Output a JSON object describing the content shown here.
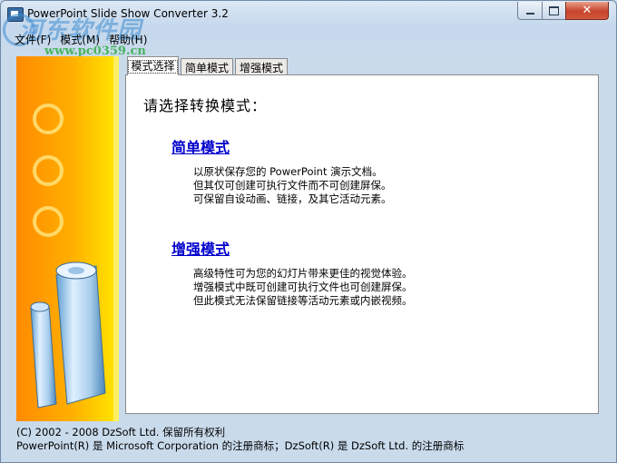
{
  "window": {
    "title": "PowerPoint Slide Show Converter 3.2",
    "minimize_icon": "minimize-icon",
    "maximize_icon": "maximize-icon",
    "close_icon": "close-icon",
    "close_glyph": "✕"
  },
  "watermark": {
    "text": "河东软件园",
    "url": "www.pc0359.cn"
  },
  "menu": {
    "items": [
      {
        "label": "文件(F)"
      },
      {
        "label": "模式(M)"
      },
      {
        "label": "帮助(H)"
      }
    ]
  },
  "tabs": [
    {
      "label": "模式选择",
      "active": true
    },
    {
      "label": "简单模式",
      "active": false
    },
    {
      "label": "增强模式",
      "active": false
    }
  ],
  "main": {
    "heading": "请选择转换模式：",
    "simple": {
      "link": "简单模式",
      "lines": [
        "以原状保存您的 PowerPoint 演示文档。",
        "但其仅可创建可执行文件而不可创建屏保。",
        "可保留自设动画、链接，及其它活动元素。"
      ]
    },
    "enhanced": {
      "link": "增强模式",
      "lines": [
        "高级特性可为您的幻灯片带来更佳的视觉体验。",
        "增强模式中既可创建可执行文件也可创建屏保。",
        "但此模式无法保留链接等活动元素或内嵌视频。"
      ]
    }
  },
  "footer": {
    "copyright": "(C) 2002 - 2008 DzSoft Ltd. 保留所有权利",
    "trademark": "PowerPoint(R) 是 Microsoft Corporation 的注册商标；DzSoft(R) 是 DzSoft Ltd. 的注册商标"
  },
  "sidebar": {
    "icon": "paper-rolls-icon",
    "ring_icon": "ring-icon"
  },
  "colors": {
    "link": "#0000cc",
    "sidebar_from": "#ff8a00",
    "sidebar_to": "#ffe800"
  }
}
